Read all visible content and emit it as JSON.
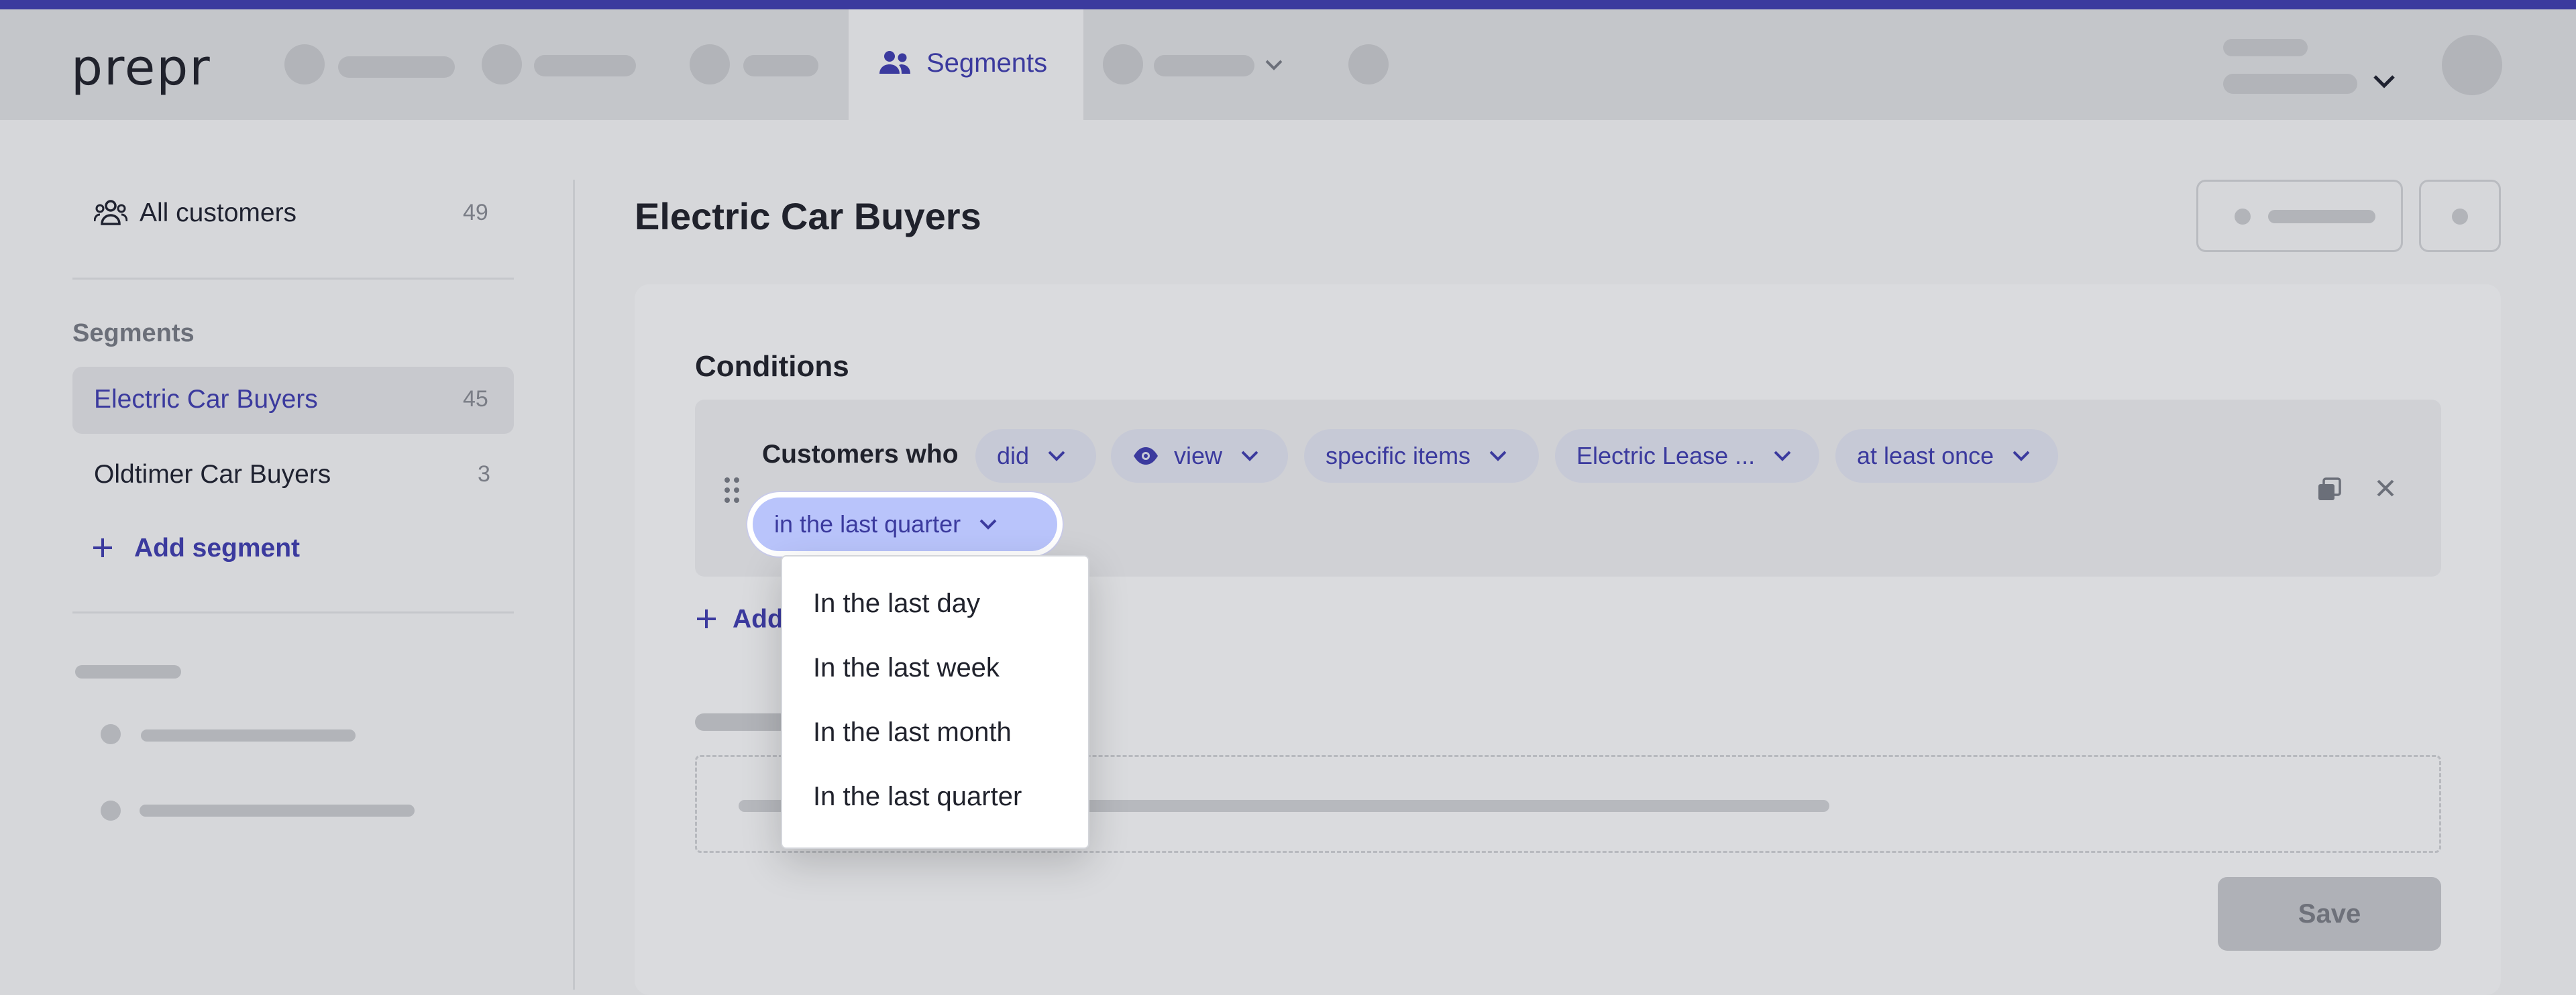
{
  "app": {
    "logo": "prepr"
  },
  "nav": {
    "active_tab": "Segments"
  },
  "sidebar": {
    "all_customers": {
      "label": "All customers",
      "count": "49"
    },
    "segments_heading": "Segments",
    "segments": [
      {
        "label": "Electric Car Buyers",
        "count": "45",
        "active": true
      },
      {
        "label": "Oldtimer Car Buyers",
        "count": "3",
        "active": false
      }
    ],
    "add_segment": "Add segment"
  },
  "main": {
    "title": "Electric Car Buyers",
    "conditions_heading": "Conditions",
    "condition": {
      "prefix": "Customers who",
      "pills": [
        "did",
        "view",
        "specific items",
        "Electric Lease ...",
        "at least once"
      ],
      "active_pill": "in the last quarter"
    },
    "add_condition_label": "Add",
    "save_label": "Save"
  },
  "dropdown": {
    "options": [
      "In the last day",
      "In the last week",
      "In the last month",
      "In the last quarter"
    ]
  },
  "colors": {
    "accent": "#3b3a9e",
    "active_pill": "#b9c4fb",
    "pill": "#c6c9d6"
  }
}
